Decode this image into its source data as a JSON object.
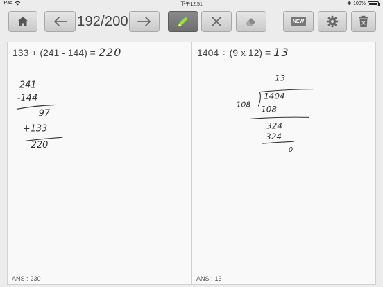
{
  "status_bar": {
    "device": "iPad",
    "time": "下午12:51",
    "battery": "100%"
  },
  "toolbar": {
    "counter": "192/200",
    "buttons": [
      {
        "name": "home",
        "icon": "home-icon"
      },
      {
        "name": "previous",
        "icon": "arrow-left-icon"
      },
      {
        "name": "next",
        "icon": "arrow-right-icon"
      },
      {
        "name": "pencil",
        "icon": "pencil-icon",
        "active": true
      },
      {
        "name": "clear",
        "icon": "x-icon"
      },
      {
        "name": "eraser",
        "icon": "eraser-icon"
      },
      {
        "name": "new",
        "icon": "new-icon",
        "label": "NEW"
      },
      {
        "name": "settings",
        "icon": "gear-icon"
      },
      {
        "name": "delete",
        "icon": "trash-icon"
      }
    ]
  },
  "problems": [
    {
      "expression": "133 + (241 - 144) =",
      "handwritten_answer": "220",
      "scratch_work": [
        "241",
        "-144",
        "97",
        "+133",
        "220"
      ],
      "ans_label": "ANS :",
      "ans_value": "230"
    },
    {
      "expression": "1404 ÷ (9 x 12) =",
      "handwritten_answer": "13",
      "scratch_work": [
        "13",
        "108",
        "1404",
        "108",
        "324",
        "324",
        "0"
      ],
      "ans_label": "ANS :",
      "ans_value": "13"
    }
  ],
  "colors": {
    "background": "#ececec",
    "panel": "#f9f9f9",
    "button": "#d4d4d4",
    "active_button": "#7a7a7a",
    "pencil_accent": "#9be03c"
  }
}
